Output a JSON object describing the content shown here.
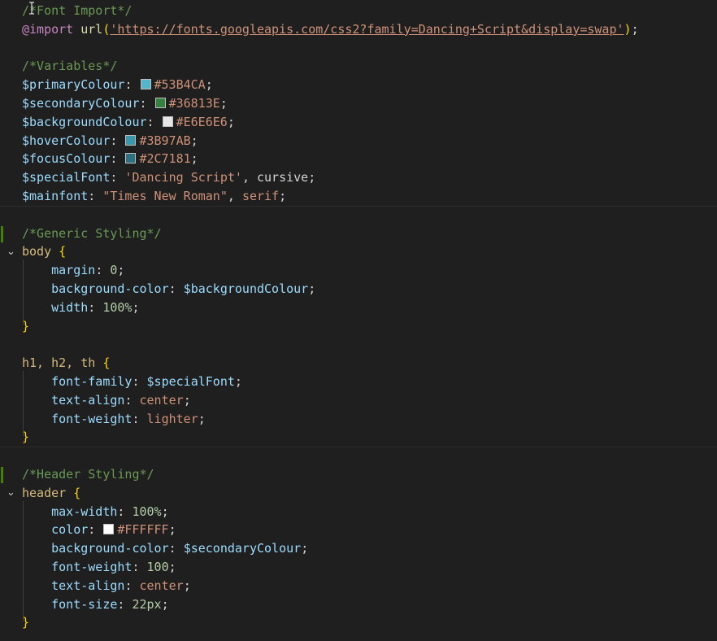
{
  "colors": {
    "primaryColour": "#53B4CA",
    "secondaryColour": "#36813E",
    "backgroundColour": "#E6E6E6",
    "hoverColour": "#3B97AB",
    "focusColour": "#2C7181",
    "white": "#FFFFFF"
  },
  "icons": {
    "cursor": "text-cursor-icon",
    "fold": "chevron-down-icon"
  },
  "lines": [
    [
      {
        "t": "c",
        "v": "/*Font Import*/"
      }
    ],
    [
      {
        "t": "at",
        "v": "@import"
      },
      {
        "t": "pl",
        "v": " "
      },
      {
        "t": "fn",
        "v": "url"
      },
      {
        "t": "br",
        "v": "("
      },
      {
        "t": "s u",
        "v": "'https://fonts.googleapis.com/css2?family=Dancing+Script&display=swap'"
      },
      {
        "t": "br",
        "v": ")"
      },
      {
        "t": "pl",
        "v": ";"
      }
    ],
    [],
    [
      {
        "t": "c",
        "v": "/*Variables*/"
      }
    ],
    [
      {
        "t": "v",
        "v": "$primaryColour"
      },
      {
        "t": "pl",
        "v": ": "
      },
      {
        "t": "sw",
        "c": "#53B4CA"
      },
      {
        "t": "s",
        "v": "#53B4CA"
      },
      {
        "t": "pl",
        "v": ";"
      }
    ],
    [
      {
        "t": "v",
        "v": "$secondaryColour"
      },
      {
        "t": "pl",
        "v": ": "
      },
      {
        "t": "sw",
        "c": "#36813E"
      },
      {
        "t": "s",
        "v": "#36813E"
      },
      {
        "t": "pl",
        "v": ";"
      }
    ],
    [
      {
        "t": "v",
        "v": "$backgroundColour"
      },
      {
        "t": "pl",
        "v": ": "
      },
      {
        "t": "sw",
        "c": "#E6E6E6"
      },
      {
        "t": "s",
        "v": "#E6E6E6"
      },
      {
        "t": "pl",
        "v": ";"
      }
    ],
    [
      {
        "t": "v",
        "v": "$hoverColour"
      },
      {
        "t": "pl",
        "v": ": "
      },
      {
        "t": "sw",
        "c": "#3B97AB"
      },
      {
        "t": "s",
        "v": "#3B97AB"
      },
      {
        "t": "pl",
        "v": ";"
      }
    ],
    [
      {
        "t": "v",
        "v": "$focusColour"
      },
      {
        "t": "pl",
        "v": ": "
      },
      {
        "t": "sw",
        "c": "#2C7181"
      },
      {
        "t": "s",
        "v": "#2C7181"
      },
      {
        "t": "pl",
        "v": ";"
      }
    ],
    [
      {
        "t": "v",
        "v": "$specialFont"
      },
      {
        "t": "pl",
        "v": ": "
      },
      {
        "t": "s",
        "v": "'Dancing Script'"
      },
      {
        "t": "pl",
        "v": ", cursive;"
      }
    ],
    [
      {
        "t": "v",
        "v": "$mainfont"
      },
      {
        "t": "pl",
        "v": ": "
      },
      {
        "t": "s",
        "v": "\"Times New Roman\""
      },
      {
        "t": "pl",
        "v": ", "
      },
      {
        "t": "s",
        "v": "serif"
      },
      {
        "t": "pl",
        "v": ";"
      }
    ],
    [],
    [
      {
        "t": "c",
        "v": "/*Generic Styling*/"
      }
    ],
    [
      {
        "t": "sel",
        "v": "body"
      },
      {
        "t": "pl",
        "v": " "
      },
      {
        "t": "br",
        "v": "{"
      }
    ],
    [
      {
        "t": "pl",
        "v": "    "
      },
      {
        "t": "p",
        "v": "margin"
      },
      {
        "t": "pl",
        "v": ": "
      },
      {
        "t": "n",
        "v": "0"
      },
      {
        "t": "pl",
        "v": ";"
      }
    ],
    [
      {
        "t": "pl",
        "v": "    "
      },
      {
        "t": "p",
        "v": "background-color"
      },
      {
        "t": "pl",
        "v": ": "
      },
      {
        "t": "v",
        "v": "$backgroundColour"
      },
      {
        "t": "pl",
        "v": ";"
      }
    ],
    [
      {
        "t": "pl",
        "v": "    "
      },
      {
        "t": "p",
        "v": "width"
      },
      {
        "t": "pl",
        "v": ": "
      },
      {
        "t": "n",
        "v": "100%"
      },
      {
        "t": "pl",
        "v": ";"
      }
    ],
    [
      {
        "t": "br",
        "v": "}"
      }
    ],
    [],
    [
      {
        "t": "sel",
        "v": "h1, h2, th"
      },
      {
        "t": "pl",
        "v": " "
      },
      {
        "t": "br",
        "v": "{"
      }
    ],
    [
      {
        "t": "pl",
        "v": "    "
      },
      {
        "t": "p",
        "v": "font-family"
      },
      {
        "t": "pl",
        "v": ": "
      },
      {
        "t": "v",
        "v": "$specialFont"
      },
      {
        "t": "pl",
        "v": ";"
      }
    ],
    [
      {
        "t": "pl",
        "v": "    "
      },
      {
        "t": "p",
        "v": "text-align"
      },
      {
        "t": "pl",
        "v": ": "
      },
      {
        "t": "s",
        "v": "center"
      },
      {
        "t": "pl",
        "v": ";"
      }
    ],
    [
      {
        "t": "pl",
        "v": "    "
      },
      {
        "t": "p",
        "v": "font-weight"
      },
      {
        "t": "pl",
        "v": ": "
      },
      {
        "t": "s",
        "v": "lighter"
      },
      {
        "t": "pl",
        "v": ";"
      }
    ],
    [
      {
        "t": "br",
        "v": "}"
      }
    ],
    [],
    [
      {
        "t": "c",
        "v": "/*Header Styling*/"
      }
    ],
    [
      {
        "t": "sel",
        "v": "header"
      },
      {
        "t": "pl",
        "v": " "
      },
      {
        "t": "br",
        "v": "{"
      }
    ],
    [
      {
        "t": "pl",
        "v": "    "
      },
      {
        "t": "p",
        "v": "max-width"
      },
      {
        "t": "pl",
        "v": ": "
      },
      {
        "t": "n",
        "v": "100%"
      },
      {
        "t": "pl",
        "v": ";"
      }
    ],
    [
      {
        "t": "pl",
        "v": "    "
      },
      {
        "t": "p",
        "v": "color"
      },
      {
        "t": "pl",
        "v": ": "
      },
      {
        "t": "sw",
        "c": "#FFFFFF"
      },
      {
        "t": "s",
        "v": "#FFFFFF"
      },
      {
        "t": "pl",
        "v": ";"
      }
    ],
    [
      {
        "t": "pl",
        "v": "    "
      },
      {
        "t": "p",
        "v": "background-color"
      },
      {
        "t": "pl",
        "v": ": "
      },
      {
        "t": "v",
        "v": "$secondaryColour"
      },
      {
        "t": "pl",
        "v": ";"
      }
    ],
    [
      {
        "t": "pl",
        "v": "    "
      },
      {
        "t": "p",
        "v": "font-weight"
      },
      {
        "t": "pl",
        "v": ": "
      },
      {
        "t": "n",
        "v": "100"
      },
      {
        "t": "pl",
        "v": ";"
      }
    ],
    [
      {
        "t": "pl",
        "v": "    "
      },
      {
        "t": "p",
        "v": "text-align"
      },
      {
        "t": "pl",
        "v": ": "
      },
      {
        "t": "s",
        "v": "center"
      },
      {
        "t": "pl",
        "v": ";"
      }
    ],
    [
      {
        "t": "pl",
        "v": "    "
      },
      {
        "t": "p",
        "v": "font-size"
      },
      {
        "t": "pl",
        "v": ": "
      },
      {
        "t": "n",
        "v": "22px"
      },
      {
        "t": "pl",
        "v": ";"
      }
    ],
    [
      {
        "t": "br",
        "v": "}"
      }
    ]
  ]
}
